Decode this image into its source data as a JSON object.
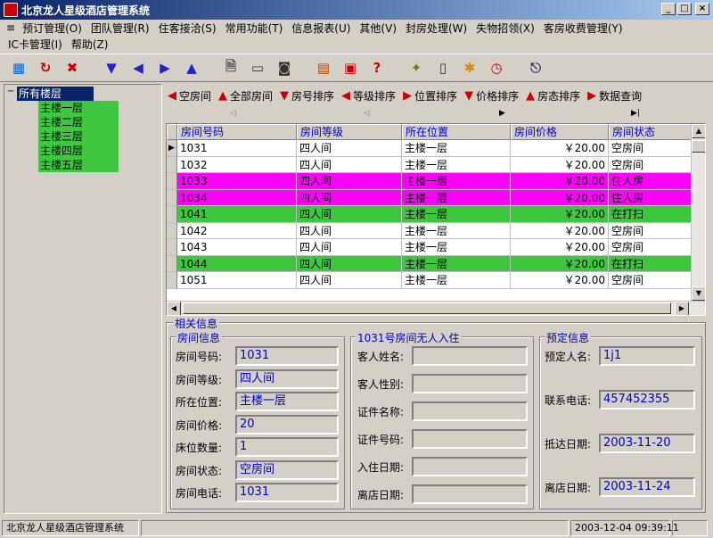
{
  "window": {
    "title": "北京龙人星级酒店管理系统"
  },
  "menu": {
    "row1": [
      "预订管理(O)",
      "团队管理(R)",
      "住客接洽(S)",
      "常用功能(T)",
      "信息报表(U)",
      "其他(V)",
      "封房处理(W)",
      "失物招领(X)",
      "客房收费管理(Y)"
    ],
    "row2": [
      "IC卡管理(I)",
      "帮助(Z)"
    ]
  },
  "tree": {
    "root": "所有楼层",
    "children": [
      "主楼一层",
      "主楼二层",
      "主楼三层",
      "主楼四层",
      "主楼五层"
    ]
  },
  "sort_toolbar": {
    "items": [
      "空房间",
      "全部房间",
      "房号排序",
      "等级排序",
      "位置排序",
      "价格排序",
      "房态排序",
      "数据查询"
    ]
  },
  "grid": {
    "columns": [
      "房间号码",
      "房间等级",
      "所在位置",
      "房间价格",
      "房间状态"
    ],
    "rows": [
      {
        "no": "1031",
        "level": "四人间",
        "loc": "主楼一层",
        "price": "￥20.00",
        "status": "空房间"
      },
      {
        "no": "1032",
        "level": "四人间",
        "loc": "主楼一层",
        "price": "￥20.00",
        "status": "空房间"
      },
      {
        "no": "1033",
        "level": "四人间",
        "loc": "主楼一层",
        "price": "￥20.00",
        "status": "住人房"
      },
      {
        "no": "1034",
        "level": "四人间",
        "loc": "主楼一层",
        "price": "￥20.00",
        "status": "住人房"
      },
      {
        "no": "1041",
        "level": "四人间",
        "loc": "主楼一层",
        "price": "￥20.00",
        "status": "在打扫"
      },
      {
        "no": "1042",
        "level": "四人间",
        "loc": "主楼一层",
        "price": "￥20.00",
        "status": "空房间"
      },
      {
        "no": "1043",
        "level": "四人间",
        "loc": "主楼一层",
        "price": "￥20.00",
        "status": "空房间"
      },
      {
        "no": "1044",
        "level": "四人间",
        "loc": "主楼一层",
        "price": "￥20.00",
        "status": "在打扫"
      },
      {
        "no": "1051",
        "level": "四人间",
        "loc": "主楼一层",
        "price": "￥20.00",
        "status": "空房间"
      }
    ],
    "status_colors": {
      "空房间": "#ffffff",
      "住人房": "#ff00ff",
      "在打扫": "#3ec73e"
    }
  },
  "related": {
    "title": "相关信息",
    "room": {
      "title": "房间信息",
      "fields": [
        {
          "label": "房间号码:",
          "value": "1031"
        },
        {
          "label": "房间等级:",
          "value": "四人间"
        },
        {
          "label": "所在位置:",
          "value": "主楼一层"
        },
        {
          "label": "房间价格:",
          "value": "20"
        },
        {
          "label": "床位数量:",
          "value": "1"
        },
        {
          "label": "房间状态:",
          "value": "空房间"
        },
        {
          "label": "房间电话:",
          "value": "1031"
        }
      ]
    },
    "guest": {
      "title": "1031号房间无人入住",
      "fields": [
        {
          "label": "客人姓名:",
          "value": ""
        },
        {
          "label": "客人性别:",
          "value": ""
        },
        {
          "label": "证件名称:",
          "value": ""
        },
        {
          "label": "证件号码:",
          "value": ""
        },
        {
          "label": "入住日期:",
          "value": ""
        },
        {
          "label": "离店日期:",
          "value": ""
        }
      ]
    },
    "booking": {
      "title": "预定信息",
      "fields": [
        {
          "label": "预定人名:",
          "value": "1j1"
        },
        {
          "label": "联系电话:",
          "value": "457452355"
        },
        {
          "label": "抵达日期:",
          "value": "2003-11-20"
        },
        {
          "label": "离店日期:",
          "value": "2003-11-24"
        }
      ]
    }
  },
  "status": {
    "left": "北京龙人星级酒店管理系统",
    "datetime": "2003-12-04 09:39:11"
  },
  "toolbar_icons": [
    "room-map-icon",
    "refresh-icon",
    "delete-icon",
    "move-down-icon",
    "move-left-icon",
    "move-right-icon",
    "move-up-icon",
    "document-icon",
    "monitor-icon",
    "camera-icon",
    "report-icon",
    "calendar-icon",
    "help-icon",
    "service-icon",
    "calculator-icon",
    "run-icon",
    "clock-icon",
    "exit-icon"
  ],
  "colors": {
    "accent_text": "#0000cc",
    "selection": "#0a246a",
    "green": "#3ec73e",
    "magenta": "#ff00ff"
  }
}
